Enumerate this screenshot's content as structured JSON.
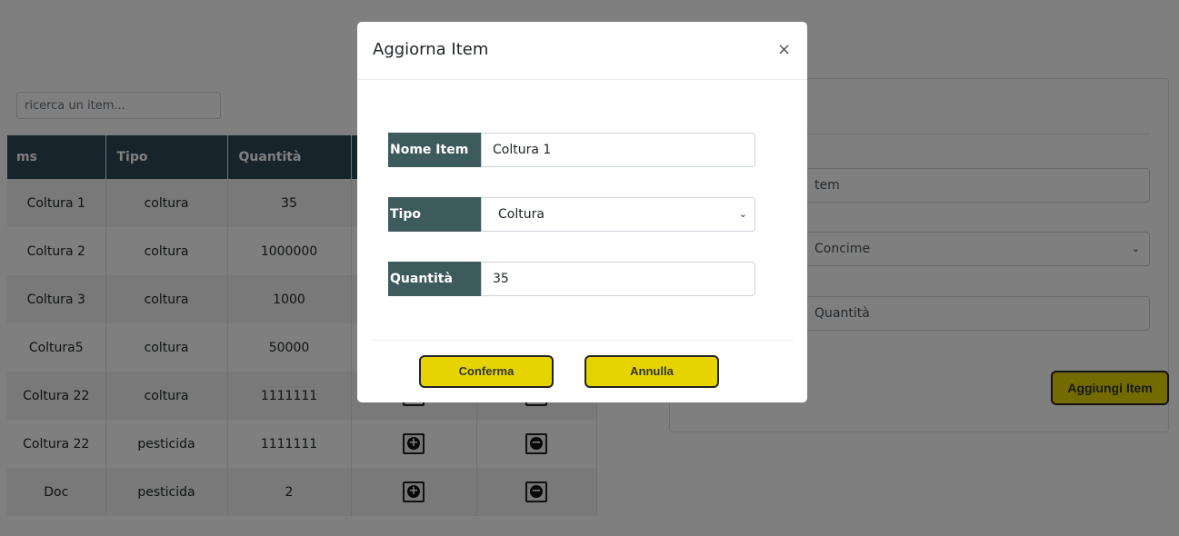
{
  "search": {
    "placeholder": "ricerca un item..."
  },
  "table": {
    "headers": [
      "ms",
      "Tipo",
      "Quantità"
    ],
    "rows": [
      {
        "name": "Coltura 1",
        "type": "coltura",
        "qty": "35"
      },
      {
        "name": "Coltura 2",
        "type": "coltura",
        "qty": "1000000"
      },
      {
        "name": "Coltura 3",
        "type": "coltura",
        "qty": "1000"
      },
      {
        "name": "Coltura5",
        "type": "coltura",
        "qty": "50000"
      },
      {
        "name": "Coltura 22",
        "type": "coltura",
        "qty": "1111111"
      },
      {
        "name": "Coltura 22",
        "type": "pesticida",
        "qty": "1111111"
      },
      {
        "name": "Doc",
        "type": "pesticida",
        "qty": "2"
      }
    ],
    "plus_icon": "plus-circle-icon",
    "minus_icon": "minus-circle-icon"
  },
  "add_card": {
    "name_placeholder": "tem",
    "type_value": "Concime",
    "qty_placeholder": "Quantità",
    "add_label": "Aggiungi Item"
  },
  "modal": {
    "title": "Aggiorna Item",
    "close": "×",
    "name_label": "Nome Item",
    "name_value": "Coltura 1",
    "type_label": "Tipo",
    "type_value": "Coltura",
    "qty_label": "Quantità",
    "qty_value": "35",
    "confirm_label": "Conferma",
    "cancel_label": "Annulla"
  },
  "colors": {
    "accent_button": "#e6d400",
    "table_header": "#2f4858",
    "label_bg": "#3d5a5c"
  }
}
